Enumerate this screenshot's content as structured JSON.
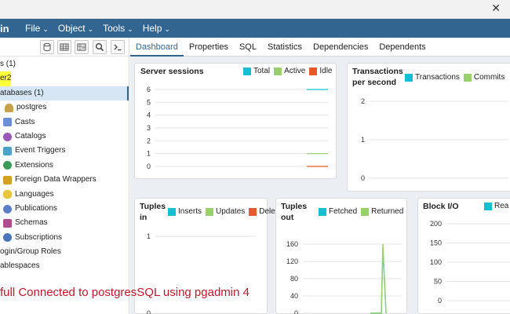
{
  "window": {
    "close_glyph": "✕"
  },
  "menubar": {
    "brand": "in",
    "items": [
      {
        "label": "File"
      },
      {
        "label": "Object"
      },
      {
        "label": "Tools"
      },
      {
        "label": "Help"
      }
    ],
    "chevron": "⌄"
  },
  "sidebar": {
    "toolbar": [
      {
        "icon": "database-icon"
      },
      {
        "icon": "table-icon"
      },
      {
        "icon": "view-icon"
      },
      {
        "icon": "search-icon"
      },
      {
        "icon": "terminal-icon"
      }
    ],
    "tree": [
      {
        "label": "s (1)",
        "indent": 0,
        "icon": "",
        "highlight": false
      },
      {
        "label": "er2",
        "indent": 0,
        "icon": "",
        "highlight": true
      },
      {
        "label": "atabases (1)",
        "indent": 0,
        "icon": "",
        "highlight": false,
        "selected": true
      },
      {
        "label": "postgres",
        "indent": 6,
        "icon": "database-icon",
        "color": "#c8a24a"
      },
      {
        "label": "Casts",
        "indent": 4,
        "icon": "casts-icon",
        "color": "#6a8fd6"
      },
      {
        "label": "Catalogs",
        "indent": 4,
        "icon": "catalogs-icon",
        "color": "#9b59b6"
      },
      {
        "label": "Event Triggers",
        "indent": 4,
        "icon": "event-triggers-icon",
        "color": "#4aa3c8"
      },
      {
        "label": "Extensions",
        "indent": 4,
        "icon": "extensions-icon",
        "color": "#3c9b5a"
      },
      {
        "label": "Foreign Data Wrappers",
        "indent": 4,
        "icon": "fdw-icon",
        "color": "#d4a31e"
      },
      {
        "label": "Languages",
        "indent": 4,
        "icon": "languages-icon",
        "color": "#e8c53a"
      },
      {
        "label": "Publications",
        "indent": 4,
        "icon": "publications-icon",
        "color": "#5b7fc7"
      },
      {
        "label": "Schemas",
        "indent": 4,
        "icon": "schemas-icon",
        "color": "#b04a8e"
      },
      {
        "label": "Subscriptions",
        "indent": 4,
        "icon": "subscriptions-icon",
        "color": "#4a74b8"
      },
      {
        "label": "ogin/Group Roles",
        "indent": 0,
        "icon": "",
        "highlight": false
      },
      {
        "label": "ablespaces",
        "indent": 0,
        "icon": "",
        "highlight": false
      }
    ]
  },
  "tabs": [
    {
      "label": "Dashboard",
      "active": true
    },
    {
      "label": "Properties"
    },
    {
      "label": "SQL"
    },
    {
      "label": "Statistics"
    },
    {
      "label": "Dependencies"
    },
    {
      "label": "Dependents"
    }
  ],
  "colors": {
    "teal": "#17becf",
    "green": "#98d06a",
    "orange": "#e8592a",
    "grid": "#e6e6e6"
  },
  "chart_data": [
    {
      "type": "line",
      "title": "Server sessions",
      "legend": [
        "Total",
        "Active",
        "Idle"
      ],
      "legend_colors": [
        "#17becf",
        "#98d06a",
        "#e8592a"
      ],
      "yticks": [
        "6",
        "5",
        "4",
        "3",
        "2",
        "1",
        "0"
      ],
      "ylim": [
        0,
        6
      ],
      "series": [
        {
          "name": "Total",
          "values": [
            6
          ]
        },
        {
          "name": "Active",
          "values": [
            1
          ]
        },
        {
          "name": "Idle",
          "values": [
            0
          ]
        }
      ]
    },
    {
      "type": "line",
      "title_lines": [
        "Transactions",
        "per second"
      ],
      "legend": [
        "Transactions",
        "Commits"
      ],
      "legend_colors": [
        "#17becf",
        "#98d06a"
      ],
      "yticks": [
        "2",
        "1",
        "0"
      ],
      "ylim": [
        0,
        2
      ]
    },
    {
      "type": "line",
      "title_lines": [
        "Tuples",
        "in"
      ],
      "legend": [
        "Inserts",
        "Updates",
        "Delet"
      ],
      "legend_colors": [
        "#17becf",
        "#98d06a",
        "#e8592a"
      ],
      "yticks": [
        "1",
        "0"
      ],
      "ylim": [
        0,
        1
      ]
    },
    {
      "type": "line",
      "title_lines": [
        "Tuples",
        "out"
      ],
      "legend": [
        "Fetched",
        "Returned"
      ],
      "legend_colors": [
        "#17becf",
        "#98d06a"
      ],
      "yticks": [
        "160",
        "120",
        "80",
        "40",
        "0"
      ],
      "ylim": [
        0,
        160
      ],
      "series": [
        {
          "name": "Fetched",
          "values": [
            0,
            0,
            0,
            150,
            0
          ]
        },
        {
          "name": "Returned",
          "values": [
            0,
            0,
            0,
            160,
            0
          ]
        }
      ]
    },
    {
      "type": "line",
      "title": "Block I/O",
      "legend": [
        "Read"
      ],
      "legend_display": [
        "Rea"
      ],
      "legend_colors": [
        "#17becf"
      ],
      "yticks": [
        "200",
        "150",
        "100",
        "50",
        "0"
      ],
      "ylim": [
        0,
        200
      ]
    }
  ],
  "caption": "full Connected to postgresSQL using pgadmin 4"
}
